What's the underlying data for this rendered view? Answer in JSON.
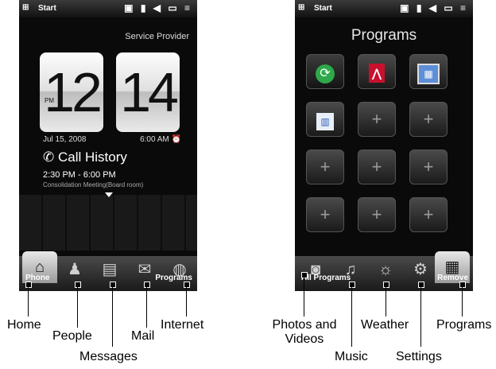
{
  "left_phone": {
    "status": {
      "start": "Start",
      "icons": "▣ ▮ ◀ ▭ ≡"
    },
    "provider": "Service Provider",
    "clock": {
      "hour": "12",
      "minute": "14",
      "ampm": "PM",
      "date": "Jul 15, 2008",
      "alarm": "6:00 AM"
    },
    "call_history": {
      "title": "Call History",
      "time": "2:30 PM - 6:00 PM",
      "detail": "Consolidation Meeting(Board room)"
    },
    "softkeys": {
      "left": "Phone",
      "right": "Programs"
    }
  },
  "right_phone": {
    "status": {
      "start": "Start",
      "icons": "▣ ▮ ◀ ▭ ≡"
    },
    "title": "Programs",
    "softkeys": {
      "left": "All Programs",
      "right": "Remove"
    },
    "empty_slot": "+"
  },
  "labels": {
    "home": "Home",
    "people": "People",
    "messages": "Messages",
    "mail": "Mail",
    "internet": "Internet",
    "photos_videos": "Photos and Videos",
    "music": "Music",
    "weather": "Weather",
    "settings": "Settings",
    "programs": "Programs"
  }
}
